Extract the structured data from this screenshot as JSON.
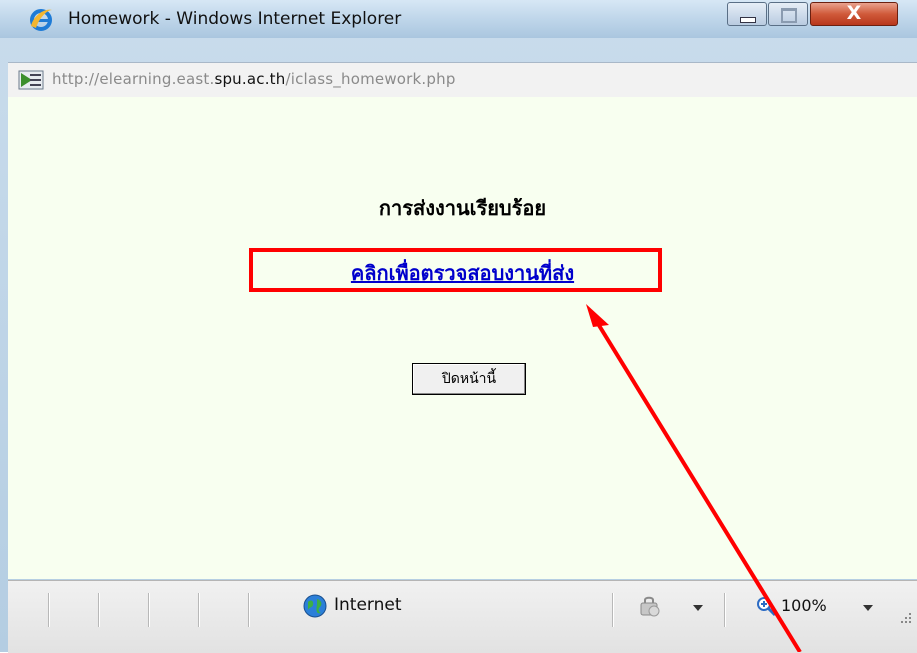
{
  "window": {
    "title": "Homework - Windows Internet Explorer",
    "close_glyph": "X"
  },
  "address_bar": {
    "url_prefix": "http://elearning.east.",
    "url_domain": "spu.ac.th",
    "url_suffix": "/iclass_homework.php",
    "icon": "page-icon"
  },
  "content": {
    "heading": "การส่งงานเรียบร้อย",
    "link_text": "คลิกเพื่อตรวจสอบงานที่ส่ง",
    "close_button_label": "ปิดหน้านี้",
    "background_color": "#f8fff0"
  },
  "status_bar": {
    "zone_label": "Internet",
    "zoom_label": "100%"
  },
  "annotation": {
    "color": "#ff0000"
  }
}
